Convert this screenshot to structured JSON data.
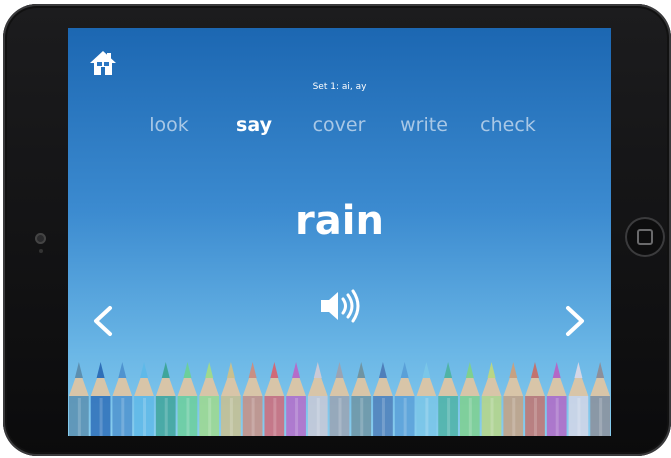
{
  "app": {
    "set_label": "Set 1: ai, ay",
    "steps": [
      "look",
      "say",
      "cover",
      "write",
      "check"
    ],
    "active_step": "say",
    "word": "rain"
  },
  "icons": {
    "home": "home-icon",
    "speaker": "speaker-icon",
    "prev": "chevron-left-icon",
    "next": "chevron-right-icon"
  },
  "colors": {
    "background_top": "#1c67b2",
    "background_bottom": "#88cdee",
    "active_text": "#ffffff",
    "inactive_text": "#a9c8e6"
  },
  "pencils": {
    "colors": [
      "#5b8fb0",
      "#2e6fb8",
      "#4f93cf",
      "#5fb9e8",
      "#3fa59a",
      "#6ccf9b",
      "#9fd98d",
      "#c9c08f",
      "#c88f84",
      "#d06a78",
      "#b56cc9",
      "#c9c9d6",
      "#9aa3b3",
      "#6f94a3",
      "#4f7fba",
      "#5aa0d8",
      "#7ac6e8",
      "#4fb3a6",
      "#7fd08e",
      "#b8d686",
      "#c6a182",
      "#c2736e",
      "#b368c6",
      "#d3d6e6",
      "#8c8f9a"
    ]
  }
}
